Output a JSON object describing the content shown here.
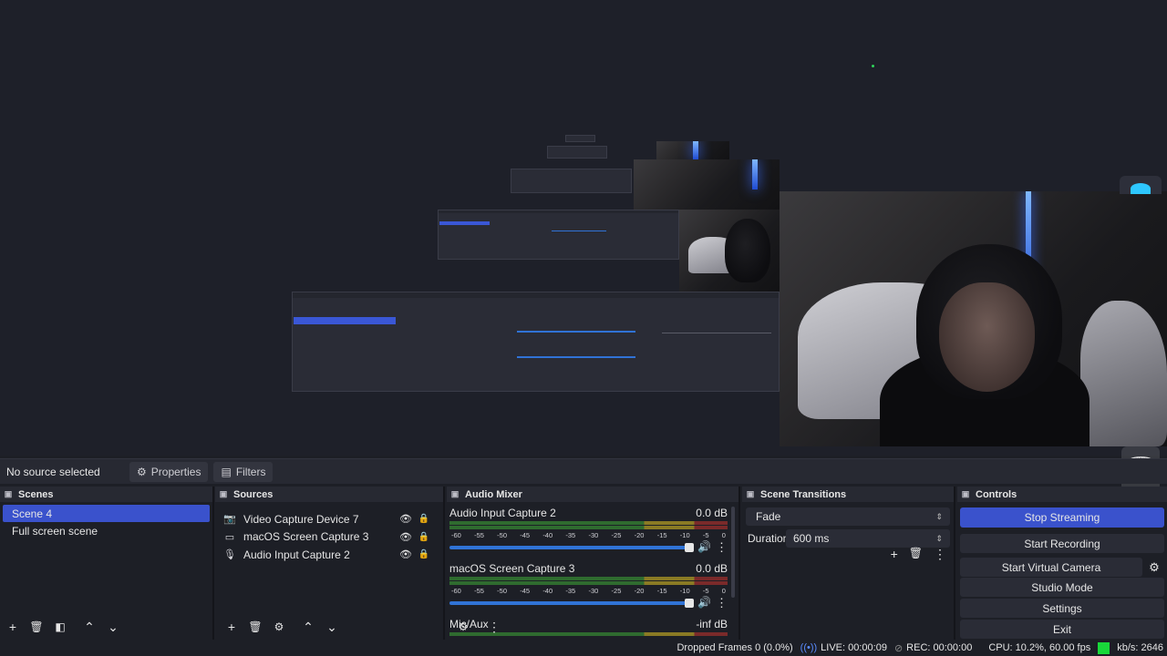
{
  "context_bar": {
    "no_source": "No source selected",
    "properties": "Properties",
    "filters": "Filters"
  },
  "scenes": {
    "title": "Scenes",
    "items": [
      "Scene 4",
      "Full screen scene"
    ]
  },
  "sources": {
    "title": "Sources",
    "items": [
      "Video Capture Device 7",
      "macOS Screen Capture 3",
      "Audio Input Capture 2"
    ]
  },
  "mixer": {
    "title": "Audio Mixer",
    "ticks": [
      "-60",
      "-55",
      "-50",
      "-45",
      "-40",
      "-35",
      "-30",
      "-25",
      "-20",
      "-15",
      "-10",
      "-5",
      "0"
    ],
    "channels": [
      {
        "name": "Audio Input Capture 2",
        "db": "0.0 dB",
        "volume": 1.0
      },
      {
        "name": "macOS Screen Capture 3",
        "db": "0.0 dB",
        "volume": 1.0
      },
      {
        "name": "Mic/Aux",
        "db": "-inf dB"
      }
    ]
  },
  "transitions": {
    "title": "Scene Transitions",
    "selected": "Fade",
    "duration_label": "Duration",
    "duration_value": "600 ms"
  },
  "controls": {
    "title": "Controls",
    "stop_streaming": "Stop Streaming",
    "start_recording": "Start Recording",
    "start_virtual_camera": "Start Virtual Camera",
    "studio_mode": "Studio Mode",
    "settings": "Settings",
    "exit": "Exit"
  },
  "status": {
    "dropped_frames": "Dropped Frames 0 (0.0%)",
    "live": "LIVE: 00:00:09",
    "rec": "REC: 00:00:00",
    "cpu": "CPU: 10.2%, 60.00 fps",
    "kbs": "kb/s: 2646"
  },
  "colors": {
    "accent": "#3a52cc",
    "bitrate_indicator": "#19d83a"
  }
}
